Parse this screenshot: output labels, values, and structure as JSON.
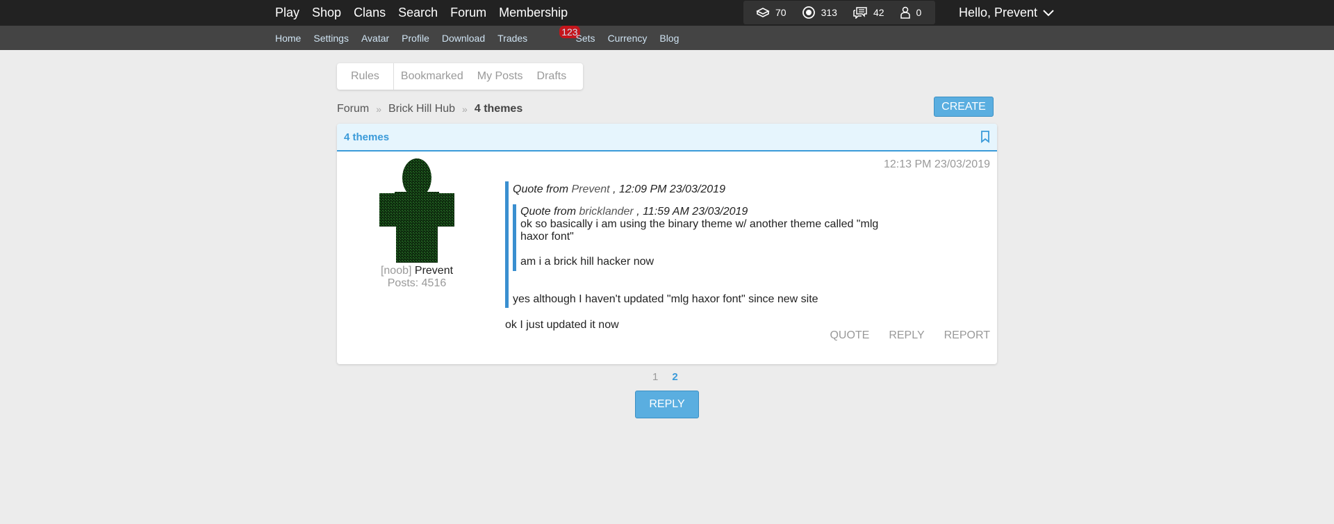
{
  "topnav": {
    "items": [
      "Play",
      "Shop",
      "Clans",
      "Search",
      "Forum",
      "Membership"
    ],
    "stats": [
      {
        "icon": "bucks-icon",
        "value": "70"
      },
      {
        "icon": "bits-icon",
        "value": "313"
      },
      {
        "icon": "messages-icon",
        "value": "42"
      },
      {
        "icon": "friends-icon",
        "value": "0"
      }
    ],
    "greeting": "Hello, Prevent"
  },
  "subnav": {
    "items": [
      "Home",
      "Settings",
      "Avatar",
      "Profile",
      "Download",
      "Trades",
      "Sets",
      "Currency",
      "Blog"
    ],
    "trades_badge": "123"
  },
  "tabs": [
    "Rules",
    "Bookmarked",
    "My Posts",
    "Drafts"
  ],
  "breadcrumb": {
    "forum": "Forum",
    "hub": "Brick Hill Hub",
    "current": "4 themes"
  },
  "create_label": "CREATE",
  "thread": {
    "title": "4 themes",
    "post": {
      "timestamp": "12:13 PM 23/03/2019",
      "author_rank": "[noob]",
      "author_name": "Prevent",
      "posts": "Posts: 4516",
      "quote_outer": {
        "prefix": "Quote from",
        "name": "Prevent",
        "suffix": ", 12:09 PM 23/03/2019",
        "quote_inner": {
          "prefix": "Quote from",
          "name": "bricklander",
          "suffix": ", 11:59 AM 23/03/2019",
          "line1": "ok so basically i am using the binary theme w/ another theme called \"mlg haxor font\"",
          "line2": "am i a brick hill hacker now"
        },
        "text": "yes although I haven't updated \"mlg haxor font\" since new site"
      },
      "text": "ok I just updated it now",
      "actions": [
        "QUOTE",
        "REPLY",
        "REPORT"
      ]
    }
  },
  "pager": [
    "1",
    "2"
  ],
  "reply_label": "REPLY",
  "colors": {
    "accent": "#3a9ad9",
    "button": "#5aaee0",
    "topbar": "#222222",
    "subbar": "#444444"
  }
}
